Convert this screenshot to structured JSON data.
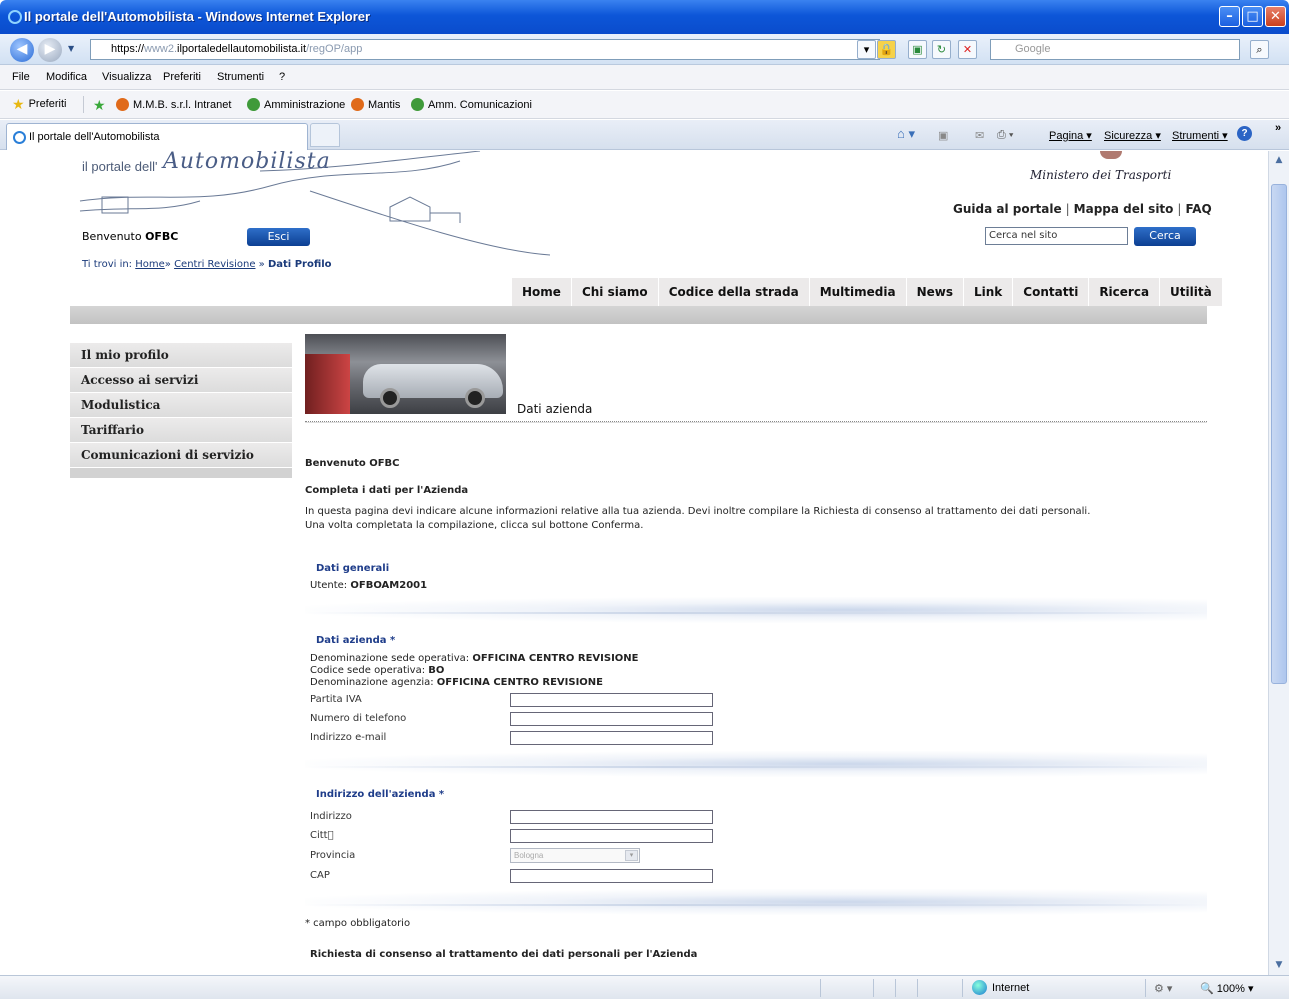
{
  "window": {
    "title": "Il portale dell'Automobilista - Windows Internet Explorer",
    "min": "–",
    "max": "□",
    "close": "✕"
  },
  "address": {
    "prefix": "https://",
    "host_dim": "www2.",
    "host": "ilportaledellautomobilista.it",
    "path": "/regOP/app",
    "search_placeholder": "Google"
  },
  "menu": [
    "File",
    "Modifica",
    "Visualizza",
    "Preferiti",
    "Strumenti",
    "?"
  ],
  "favorites": {
    "label": "Preferiti",
    "items": [
      "M.M.B. s.r.l. Intranet",
      "Amministrazione",
      "Mantis",
      "Amm. Comunicazioni"
    ],
    "colors": [
      "#e06a1a",
      "#3f9a3a",
      "#e06a1a",
      "#3f9a3a"
    ]
  },
  "tab": {
    "title": "Il portale dell'Automobilista",
    "commands": [
      "Pagina ▾",
      "Sicurezza ▾",
      "Strumenti ▾"
    ]
  },
  "header": {
    "logo_prefix": "il portale dell'",
    "logo_script": "Automobilista",
    "ministero": "Ministero dei Trasporti",
    "links": [
      "Guida al portale",
      "Mappa del sito",
      "FAQ"
    ],
    "search_value": "Cerca nel sito",
    "search_button": "Cerca",
    "welcome_label": "Benvenuto",
    "welcome_user": "OFBC",
    "logout_button": "Esci",
    "breadcrumb_label": "Ti trovi in:",
    "breadcrumb": [
      "Home",
      "Centri Revisione",
      "Dati Profilo"
    ]
  },
  "nav": [
    "Home",
    "Chi siamo",
    "Codice della strada",
    "Multimedia",
    "News",
    "Link",
    "Contatti",
    "Ricerca",
    "Utilità"
  ],
  "sidebar": [
    "Il mio profilo",
    "Accesso ai servizi",
    "Modulistica",
    "Tariffario",
    "Comunicazioni di servizio"
  ],
  "content": {
    "section_heading": "Dati azienda",
    "welcome": "Benvenuto OFBC",
    "complete_title": "Completa i dati per l'Azienda",
    "intro_1": "In questa pagina devi indicare alcune informazioni relative alla tua azienda. Devi inoltre compilare la Richiesta di consenso al trattamento dei dati personali.",
    "intro_2": "Una volta completata la compilazione, clicca sul bottone Conferma.",
    "generali_title": "Dati generali",
    "utente_label": "Utente:",
    "utente_value": "OFBOAM2001",
    "azienda_title": "Dati azienda *",
    "den_sede_label": "Denominazione sede operativa:",
    "den_sede_value": "OFFICINA CENTRO REVISIONE",
    "cod_sede_label": "Codice sede operativa:",
    "cod_sede_value": "BO",
    "den_agenzia_label": "Denominazione agenzia:",
    "den_agenzia_value": "OFFICINA CENTRO REVISIONE",
    "partita_iva": "Partita IVA",
    "telefono": "Numero di telefono",
    "email": "Indirizzo e-mail",
    "indirizzo_title": "Indirizzo dell'azienda *",
    "indirizzo": "Indirizzo",
    "citta": "Citt\u0000",
    "provincia": "Provincia",
    "provincia_value": "Bologna",
    "cap": "CAP",
    "obbligatorio": "* campo obbligatorio",
    "consenso_title": "Richiesta di consenso al trattamento dei dati personali per l'Azienda"
  },
  "status": {
    "zone": "Internet",
    "zoom": "100%"
  }
}
